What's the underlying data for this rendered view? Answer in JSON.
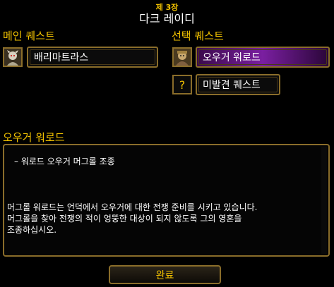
{
  "header": {
    "chapter": "제 3장",
    "title": "다크 레이디"
  },
  "main_quest": {
    "label": "메인 퀘스트",
    "item": "배리마트라스",
    "icon": "npc-portrait-icon"
  },
  "optional_quest": {
    "label": "선택 퀘스트",
    "items": [
      {
        "label": "오우거 워로드",
        "icon": "npc-portrait-icon",
        "selected": true
      },
      {
        "label": "미발견 퀘스트",
        "icon": "question-mark-icon",
        "selected": false
      }
    ]
  },
  "detail": {
    "title": "오우거 워로드",
    "objective": "–  워로드 오우거 머그롤 조종",
    "description": "머그롤 워로드는 언덕에서 오우거에 대한 전쟁 준비를 시키고 있습니다.\n머그롤을 찾아 전쟁의 적이 엉뚱한 대상이 되지 않도록 그의 영혼을\n조종하십시오."
  },
  "buttons": {
    "complete": "완료"
  },
  "colors": {
    "gold": "#f2c200",
    "border": "#8a6d2a",
    "selected": "#7a1fa0"
  }
}
